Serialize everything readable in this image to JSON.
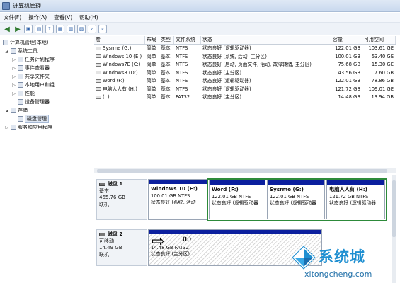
{
  "window": {
    "title": "计算机管理"
  },
  "menu": [
    "文件(F)",
    "操作(A)",
    "查看(V)",
    "帮助(H)"
  ],
  "tree": [
    {
      "label": "计算机管理(本地)",
      "level": 0,
      "exp": ""
    },
    {
      "label": "系统工具",
      "level": 1,
      "exp": "◢"
    },
    {
      "label": "任务计划程序",
      "level": 2,
      "exp": "▷"
    },
    {
      "label": "事件查看器",
      "level": 2,
      "exp": "▷"
    },
    {
      "label": "共享文件夹",
      "level": 2,
      "exp": "▷"
    },
    {
      "label": "本地用户和组",
      "level": 2,
      "exp": "▷"
    },
    {
      "label": "性能",
      "level": 2,
      "exp": "▷"
    },
    {
      "label": "设备管理器",
      "level": 2,
      "exp": ""
    },
    {
      "label": "存储",
      "level": 1,
      "exp": "◢"
    },
    {
      "label": "磁盘管理",
      "level": 2,
      "exp": "",
      "selected": true
    },
    {
      "label": "服务和应用程序",
      "level": 1,
      "exp": "▷"
    }
  ],
  "columns": [
    "卷",
    "布局",
    "类型",
    "文件系统",
    "状态",
    "容量",
    "可用空间"
  ],
  "volumes": [
    [
      "Sysrme (G:)",
      "简单",
      "基本",
      "NTFS",
      "状态良好 (逻辑驱动器)",
      "122.01 GB",
      "103.61 GE"
    ],
    [
      "Windows 10 (E:)",
      "简单",
      "基本",
      "NTFS",
      "状态良好 (系统, 活动, 主分区)",
      "100.01 GB",
      "53.40 GE"
    ],
    [
      "Windows7E (C:)",
      "简单",
      "基本",
      "NTFS",
      "状态良好 (启动, 页面文件, 活动, 故障转储, 主分区)",
      "75.68 GB",
      "15.30 GE"
    ],
    [
      "Windows8 (D:)",
      "简单",
      "基本",
      "NTFS",
      "状态良好 (主分区)",
      "43.56 GB",
      "7.60 GB"
    ],
    [
      "Word (F:)",
      "简单",
      "基本",
      "NTFS",
      "状态良好 (逻辑驱动器)",
      "122.01 GB",
      "78.86 GB"
    ],
    [
      "电脑人人有 (H:)",
      "简单",
      "基本",
      "NTFS",
      "状态良好 (逻辑驱动器)",
      "121.72 GB",
      "109.01 GE"
    ],
    [
      "(I:)",
      "简单",
      "基本",
      "FAT32",
      "状态良好 (主分区)",
      "14.48 GB",
      "13.94 GB"
    ]
  ],
  "disk1": {
    "name": "磁盘 1",
    "type": "基本",
    "size": "465.76 GB",
    "status": "联机",
    "partitions": [
      {
        "name": "Windows 10 (E:)",
        "size": "100.01 GB NTFS",
        "status": "状态良好 (系统, 活动"
      },
      {
        "name": "Word (F:)",
        "size": "122.01 GB NTFS",
        "status": "状态良好 (逻辑驱动器"
      },
      {
        "name": "Sysrme (G:)",
        "size": "122.01 GB NTFS",
        "status": "状态良好 (逻辑驱动器"
      },
      {
        "name": "电脑人人有 (H:)",
        "size": "121.72 GB NTFS",
        "status": "状态良好 (逻辑驱动器"
      }
    ]
  },
  "disk2": {
    "name": "磁盘 2",
    "type": "可移动",
    "size": "14.49 GB",
    "status": "联机",
    "partition": {
      "name": "(I:)",
      "size": "14.48 GB FAT32",
      "status": "状态良好 (主分区)"
    }
  },
  "watermark": {
    "cn": "系统城",
    "en": "xitongcheng.com"
  }
}
